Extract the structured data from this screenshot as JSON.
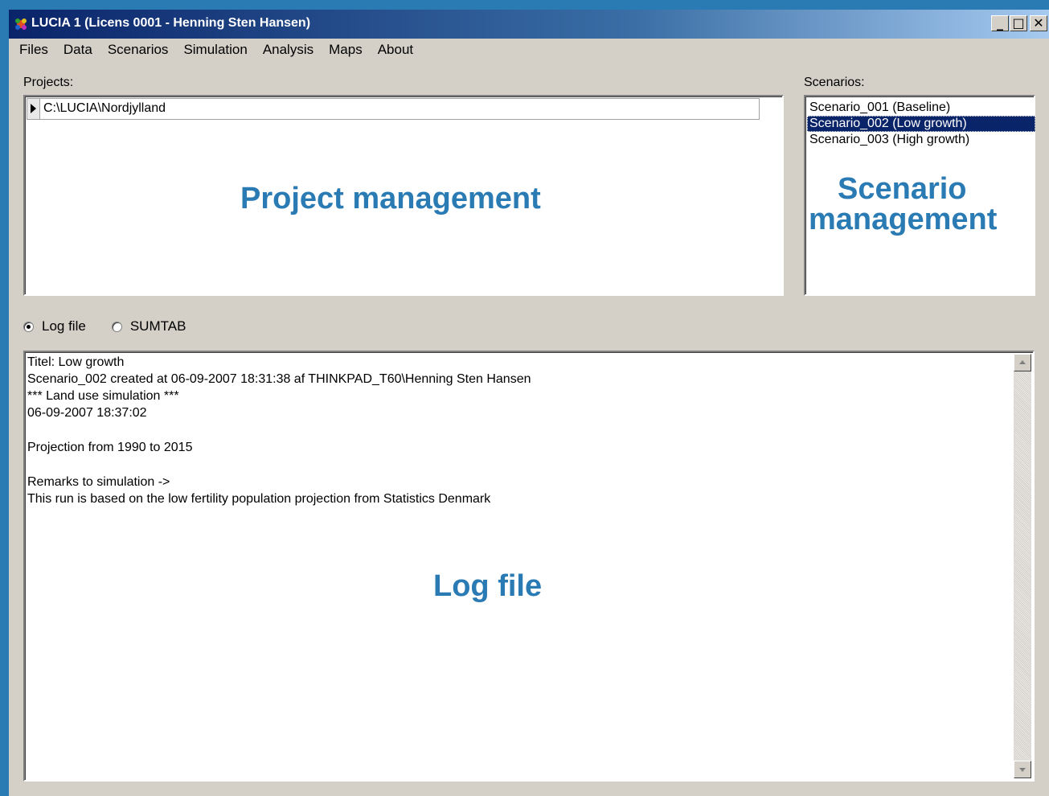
{
  "window": {
    "title": "LUCIA 1 (Licens 0001 - Henning Sten Hansen)",
    "controls": {
      "minimize": "_",
      "maximize": "□",
      "close": "✕"
    }
  },
  "menu": [
    "Files",
    "Data",
    "Scenarios",
    "Simulation",
    "Analysis",
    "Maps",
    "About"
  ],
  "projects": {
    "label": "Projects:",
    "rows": [
      "C:\\LUCIA\\Nordjylland"
    ]
  },
  "scenarios": {
    "label": "Scenarios:",
    "items": [
      "Scenario_001 (Baseline)",
      "Scenario_002 (Low growth)",
      "Scenario_003 (High growth)"
    ],
    "selected_index": 1
  },
  "view_options": {
    "options": [
      "Log file",
      "SUMTAB"
    ],
    "selected": "Log file"
  },
  "log": {
    "lines": [
      "Titel: Low growth",
      "Scenario_002 created at 06-09-2007 18:31:38 af THINKPAD_T60\\Henning Sten Hansen",
      "*** Land use simulation ***",
      "06-09-2007 18:37:02",
      "",
      "Projection from 1990 to 2015",
      "",
      "Remarks to simulation ->",
      "This run is based on the low fertility population projection from Statistics Denmark"
    ]
  },
  "annotations": {
    "project": "Project management",
    "scenario_line1": "Scenario",
    "scenario_line2": "management",
    "log": "Log file",
    "color": "#2a7bb4"
  },
  "colors": {
    "selection": "#0a246a",
    "window_face": "#d4d0c8",
    "desktop": "#2a7bb4"
  }
}
